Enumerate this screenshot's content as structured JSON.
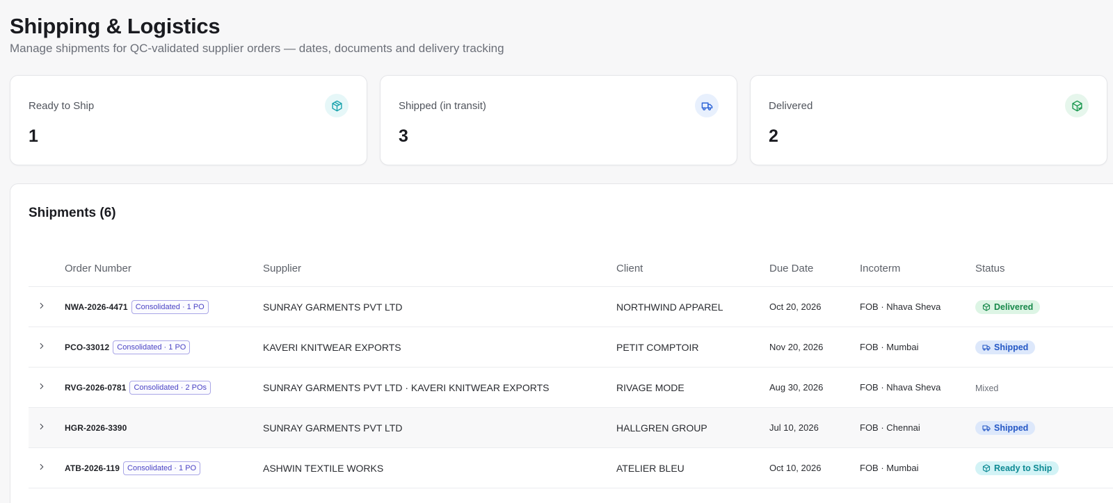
{
  "header": {
    "title": "Shipping & Logistics",
    "subtitle": "Manage shipments for QC-validated supplier orders — dates, documents and delivery tracking"
  },
  "stats": [
    {
      "label": "Ready to Ship",
      "value": "1",
      "icon": "package-icon",
      "color": "#1aa3ad"
    },
    {
      "label": "Shipped (in transit)",
      "value": "3",
      "icon": "truck-icon",
      "color": "#2c63d6"
    },
    {
      "label": "Delivered",
      "value": "2",
      "icon": "package-check-icon",
      "color": "#1f9a53"
    }
  ],
  "shipments": {
    "title": "Shipments (6)",
    "columns": {
      "order": "Order Number",
      "supplier": "Supplier",
      "client": "Client",
      "due": "Due Date",
      "incoterm": "Incoterm",
      "status": "Status"
    },
    "rows": [
      {
        "order": "NWA-2026-4471",
        "badge": "Consolidated · 1 PO",
        "supplier": "SUNRAY GARMENTS PVT LTD",
        "client": "NORTHWIND APPAREL",
        "due": "Oct 20, 2026",
        "incoterm": "FOB · Nhava Sheva",
        "status": "Delivered"
      },
      {
        "order": "PCO-33012",
        "badge": "Consolidated · 1 PO",
        "supplier": "KAVERI KNITWEAR EXPORTS",
        "client": "PETIT COMPTOIR",
        "due": "Nov 20, 2026",
        "incoterm": "FOB · Mumbai",
        "status": "Shipped"
      },
      {
        "order": "RVG-2026-0781",
        "badge": "Consolidated · 2 POs",
        "supplier": "SUNRAY GARMENTS PVT LTD · KAVERI KNITWEAR EXPORTS",
        "client": "RIVAGE MODE",
        "due": "Aug 30, 2026",
        "incoterm": "FOB · Nhava Sheva",
        "status": "Mixed"
      },
      {
        "order": "HGR-2026-3390",
        "badge": "",
        "supplier": "SUNRAY GARMENTS PVT LTD",
        "client": "HALLGREN GROUP",
        "due": "Jul 10, 2026",
        "incoterm": "FOB · Chennai",
        "status": "Shipped"
      },
      {
        "order": "ATB-2026-119",
        "badge": "Consolidated · 1 PO",
        "supplier": "ASHWIN TEXTILE WORKS",
        "client": "ATELIER BLEU",
        "due": "Oct 10, 2026",
        "incoterm": "FOB · Mumbai",
        "status": "Ready to Ship"
      }
    ]
  }
}
